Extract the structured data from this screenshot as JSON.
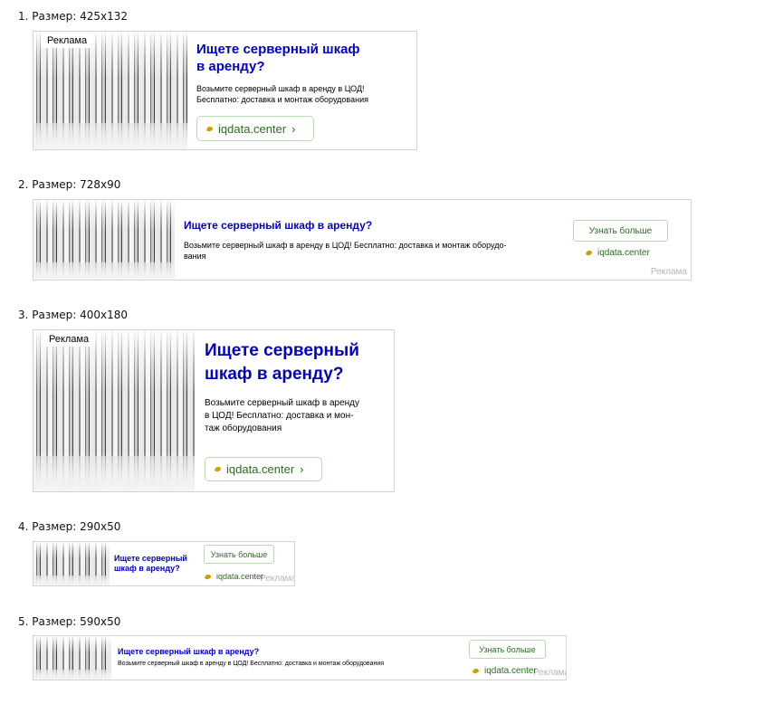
{
  "ad": {
    "tag": "Реклама",
    "title": "Ищете серверный шкаф в аренду?",
    "text": "Возьмите серверный шкаф в аренду в ЦОД! Бесплатно: доставка и монтаж оборудования",
    "domain": "iqdata.center",
    "more_button": "Узнать больше",
    "chevron": "›",
    "favicon": "iqdata-favicon-icon"
  },
  "variants": [
    {
      "caption": "1. Размер: 425x132",
      "title_l1": "Ищете серверный шкаф",
      "title_l2": "в аренду?",
      "text_l1": "Возьмите серверный шкаф в аренду в ЦОД!",
      "text_l2": "Бесплатно: доставка и монтаж оборудования"
    },
    {
      "caption": "2. Размер: 728x90",
      "text_l1": "Возьмите серверный шкаф в аренду в ЦОД! Бесплатно: доставка и монтаж оборудо-",
      "text_l2": "вания"
    },
    {
      "caption": "3. Размер: 400x180",
      "title_l1": "Ищете серверный",
      "title_l2": "шкаф в аренду?",
      "text_l1": "Возьмите серверный шкаф в аренду",
      "text_l2": "в ЦОД! Бесплатно: доставка и мон-",
      "text_l3": "таж оборудования"
    },
    {
      "caption": "4. Размер: 290x50",
      "title_l1": "Ищете серверный",
      "title_l2": "шкаф в аренду?"
    },
    {
      "caption": "5. Размер: 590x50"
    }
  ],
  "colors": {
    "title": "#0000cc",
    "domain": "#2a6e1f",
    "border": "#d3d3d3",
    "favicon": "#c9a200"
  }
}
